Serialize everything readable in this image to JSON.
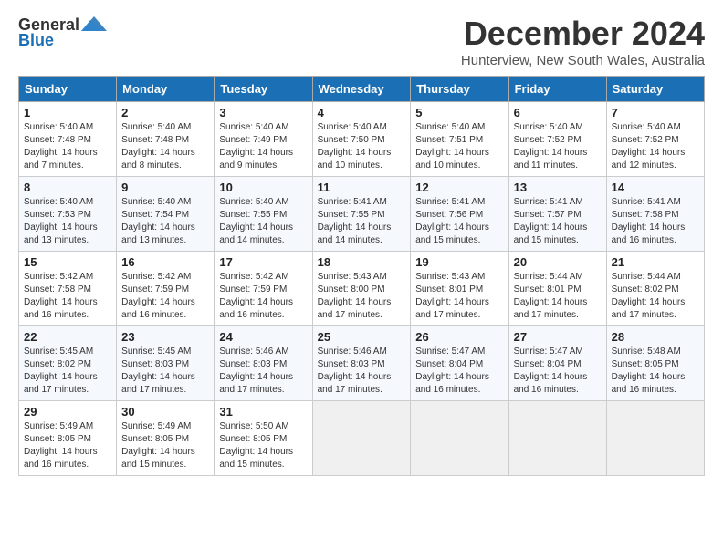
{
  "logo": {
    "general": "General",
    "blue": "Blue"
  },
  "title": "December 2024",
  "subtitle": "Hunterview, New South Wales, Australia",
  "days_header": [
    "Sunday",
    "Monday",
    "Tuesday",
    "Wednesday",
    "Thursday",
    "Friday",
    "Saturday"
  ],
  "weeks": [
    [
      {
        "day": "1",
        "sunrise": "5:40 AM",
        "sunset": "7:48 PM",
        "daylight": "14 hours and 7 minutes."
      },
      {
        "day": "2",
        "sunrise": "5:40 AM",
        "sunset": "7:48 PM",
        "daylight": "14 hours and 8 minutes."
      },
      {
        "day": "3",
        "sunrise": "5:40 AM",
        "sunset": "7:49 PM",
        "daylight": "14 hours and 9 minutes."
      },
      {
        "day": "4",
        "sunrise": "5:40 AM",
        "sunset": "7:50 PM",
        "daylight": "14 hours and 10 minutes."
      },
      {
        "day": "5",
        "sunrise": "5:40 AM",
        "sunset": "7:51 PM",
        "daylight": "14 hours and 10 minutes."
      },
      {
        "day": "6",
        "sunrise": "5:40 AM",
        "sunset": "7:52 PM",
        "daylight": "14 hours and 11 minutes."
      },
      {
        "day": "7",
        "sunrise": "5:40 AM",
        "sunset": "7:52 PM",
        "daylight": "14 hours and 12 minutes."
      }
    ],
    [
      {
        "day": "8",
        "sunrise": "5:40 AM",
        "sunset": "7:53 PM",
        "daylight": "14 hours and 13 minutes."
      },
      {
        "day": "9",
        "sunrise": "5:40 AM",
        "sunset": "7:54 PM",
        "daylight": "14 hours and 13 minutes."
      },
      {
        "day": "10",
        "sunrise": "5:40 AM",
        "sunset": "7:55 PM",
        "daylight": "14 hours and 14 minutes."
      },
      {
        "day": "11",
        "sunrise": "5:41 AM",
        "sunset": "7:55 PM",
        "daylight": "14 hours and 14 minutes."
      },
      {
        "day": "12",
        "sunrise": "5:41 AM",
        "sunset": "7:56 PM",
        "daylight": "14 hours and 15 minutes."
      },
      {
        "day": "13",
        "sunrise": "5:41 AM",
        "sunset": "7:57 PM",
        "daylight": "14 hours and 15 minutes."
      },
      {
        "day": "14",
        "sunrise": "5:41 AM",
        "sunset": "7:58 PM",
        "daylight": "14 hours and 16 minutes."
      }
    ],
    [
      {
        "day": "15",
        "sunrise": "5:42 AM",
        "sunset": "7:58 PM",
        "daylight": "14 hours and 16 minutes."
      },
      {
        "day": "16",
        "sunrise": "5:42 AM",
        "sunset": "7:59 PM",
        "daylight": "14 hours and 16 minutes."
      },
      {
        "day": "17",
        "sunrise": "5:42 AM",
        "sunset": "7:59 PM",
        "daylight": "14 hours and 16 minutes."
      },
      {
        "day": "18",
        "sunrise": "5:43 AM",
        "sunset": "8:00 PM",
        "daylight": "14 hours and 17 minutes."
      },
      {
        "day": "19",
        "sunrise": "5:43 AM",
        "sunset": "8:01 PM",
        "daylight": "14 hours and 17 minutes."
      },
      {
        "day": "20",
        "sunrise": "5:44 AM",
        "sunset": "8:01 PM",
        "daylight": "14 hours and 17 minutes."
      },
      {
        "day": "21",
        "sunrise": "5:44 AM",
        "sunset": "8:02 PM",
        "daylight": "14 hours and 17 minutes."
      }
    ],
    [
      {
        "day": "22",
        "sunrise": "5:45 AM",
        "sunset": "8:02 PM",
        "daylight": "14 hours and 17 minutes."
      },
      {
        "day": "23",
        "sunrise": "5:45 AM",
        "sunset": "8:03 PM",
        "daylight": "14 hours and 17 minutes."
      },
      {
        "day": "24",
        "sunrise": "5:46 AM",
        "sunset": "8:03 PM",
        "daylight": "14 hours and 17 minutes."
      },
      {
        "day": "25",
        "sunrise": "5:46 AM",
        "sunset": "8:03 PM",
        "daylight": "14 hours and 17 minutes."
      },
      {
        "day": "26",
        "sunrise": "5:47 AM",
        "sunset": "8:04 PM",
        "daylight": "14 hours and 16 minutes."
      },
      {
        "day": "27",
        "sunrise": "5:47 AM",
        "sunset": "8:04 PM",
        "daylight": "14 hours and 16 minutes."
      },
      {
        "day": "28",
        "sunrise": "5:48 AM",
        "sunset": "8:05 PM",
        "daylight": "14 hours and 16 minutes."
      }
    ],
    [
      {
        "day": "29",
        "sunrise": "5:49 AM",
        "sunset": "8:05 PM",
        "daylight": "14 hours and 16 minutes."
      },
      {
        "day": "30",
        "sunrise": "5:49 AM",
        "sunset": "8:05 PM",
        "daylight": "14 hours and 15 minutes."
      },
      {
        "day": "31",
        "sunrise": "5:50 AM",
        "sunset": "8:05 PM",
        "daylight": "14 hours and 15 minutes."
      },
      null,
      null,
      null,
      null
    ]
  ]
}
